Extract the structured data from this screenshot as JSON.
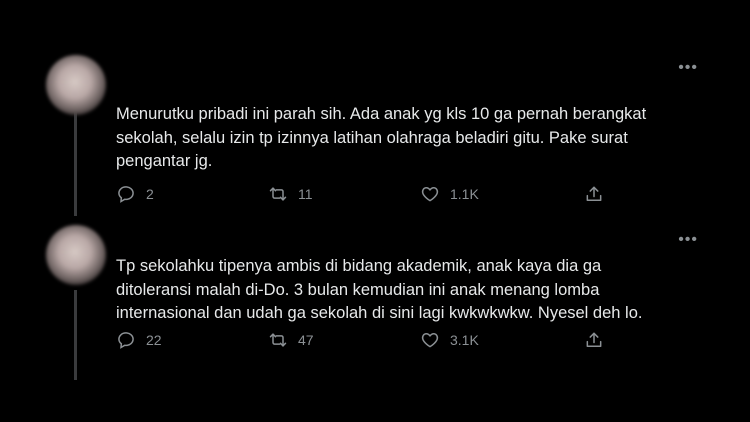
{
  "tweets": [
    {
      "text_lines": [
        "Menurutku pribadi ini parah sih. Ada anak yg kls 10 ga pernah berangkat",
        "sekolah, selalu izin tp izinnya latihan olahraga beladiri gitu. Pake surat",
        "pengantar jg."
      ],
      "reply_count": "2",
      "retweet_count": "11",
      "like_count": "1.1K"
    },
    {
      "text_lines": [
        "Tp sekolahku tipenya ambis di bidang akademik, anak kaya dia ga",
        "ditoleransi malah di-Do. 3 bulan kemudian ini anak menang lomba",
        "internasional dan udah ga sekolah di sini lagi kwkwkwkw. Nyesel deh lo."
      ],
      "reply_count": "22",
      "retweet_count": "47",
      "like_count": "3.1K"
    }
  ],
  "more_glyph": "•••",
  "icons": {
    "reply": "reply-icon",
    "retweet": "retweet-icon",
    "like": "heart-icon",
    "share": "share-icon",
    "more": "more-icon"
  },
  "colors": {
    "background": "#000000",
    "text": "#e7e9ea",
    "muted": "#8b9094",
    "thread_line": "#3a3b3d"
  }
}
